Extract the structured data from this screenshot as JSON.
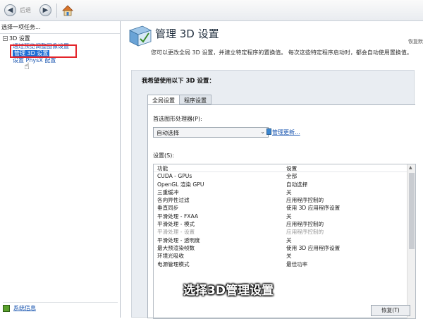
{
  "toolbar": {
    "back_label": "后退",
    "back_icon": "back-arrow-icon",
    "forward_icon": "forward-arrow-icon",
    "home_icon": "home-icon"
  },
  "left_panel": {
    "header": "选择一项任务...",
    "tree": {
      "root_label": "3D 设置",
      "items": [
        {
          "label": "通过预览调整图像设置",
          "selected": false
        },
        {
          "label": "管理 3D 设置",
          "selected": true
        },
        {
          "label": "设置 PhysX 配置",
          "selected": false
        }
      ]
    },
    "system_info_link": "系统信息"
  },
  "main": {
    "title": "管理 3D 设置",
    "restore_link": "恢复默",
    "description": "您可以更改全局 3D 设置，并建立特定程序的置换值。 每次这些特定程序启动时，都会自动使用置换值。",
    "section_title": "我希望使用以下 3D 设置：",
    "tabs": [
      {
        "label": "全局设置",
        "active": true
      },
      {
        "label": "程序设置",
        "active": false
      }
    ],
    "processor_label": "首选图形处理器(P):",
    "processor_value": "自动选择",
    "manage_link": "管理更新...",
    "settings_label": "设置(S):",
    "table": {
      "headers": [
        "功能",
        "设置"
      ],
      "rows": [
        {
          "feature": "CUDA - GPUs",
          "value": "全部",
          "disabled": false
        },
        {
          "feature": "OpenGL 渲染 GPU",
          "value": "自动选择",
          "disabled": false
        },
        {
          "feature": "三重缓冲",
          "value": "关",
          "disabled": false
        },
        {
          "feature": "各向异性过滤",
          "value": "应用程序控制的",
          "disabled": false
        },
        {
          "feature": "垂直同步",
          "value": "使用 3D 应用程序设置",
          "disabled": false
        },
        {
          "feature": "平滑处理 - FXAA",
          "value": "关",
          "disabled": false
        },
        {
          "feature": "平滑处理 - 模式",
          "value": "应用程序控制的",
          "disabled": false
        },
        {
          "feature": "平滑处理 - 设置",
          "value": "应用程序控制的",
          "disabled": true
        },
        {
          "feature": "平滑处理 - 透明度",
          "value": "关",
          "disabled": false
        },
        {
          "feature": "最大预渲染帧数",
          "value": "使用 3D 应用程序设置",
          "disabled": false
        },
        {
          "feature": "环境光吸收",
          "value": "关",
          "disabled": false
        },
        {
          "feature": "电源管理模式",
          "value": "最佳功率",
          "disabled": false
        }
      ]
    },
    "restore_button": "恢复(T)"
  },
  "caption": "选择3D管理设置",
  "colors": {
    "selection_blue": "#1f6fd6",
    "link_blue": "#1a56b0",
    "highlight_red": "#e4252b"
  }
}
